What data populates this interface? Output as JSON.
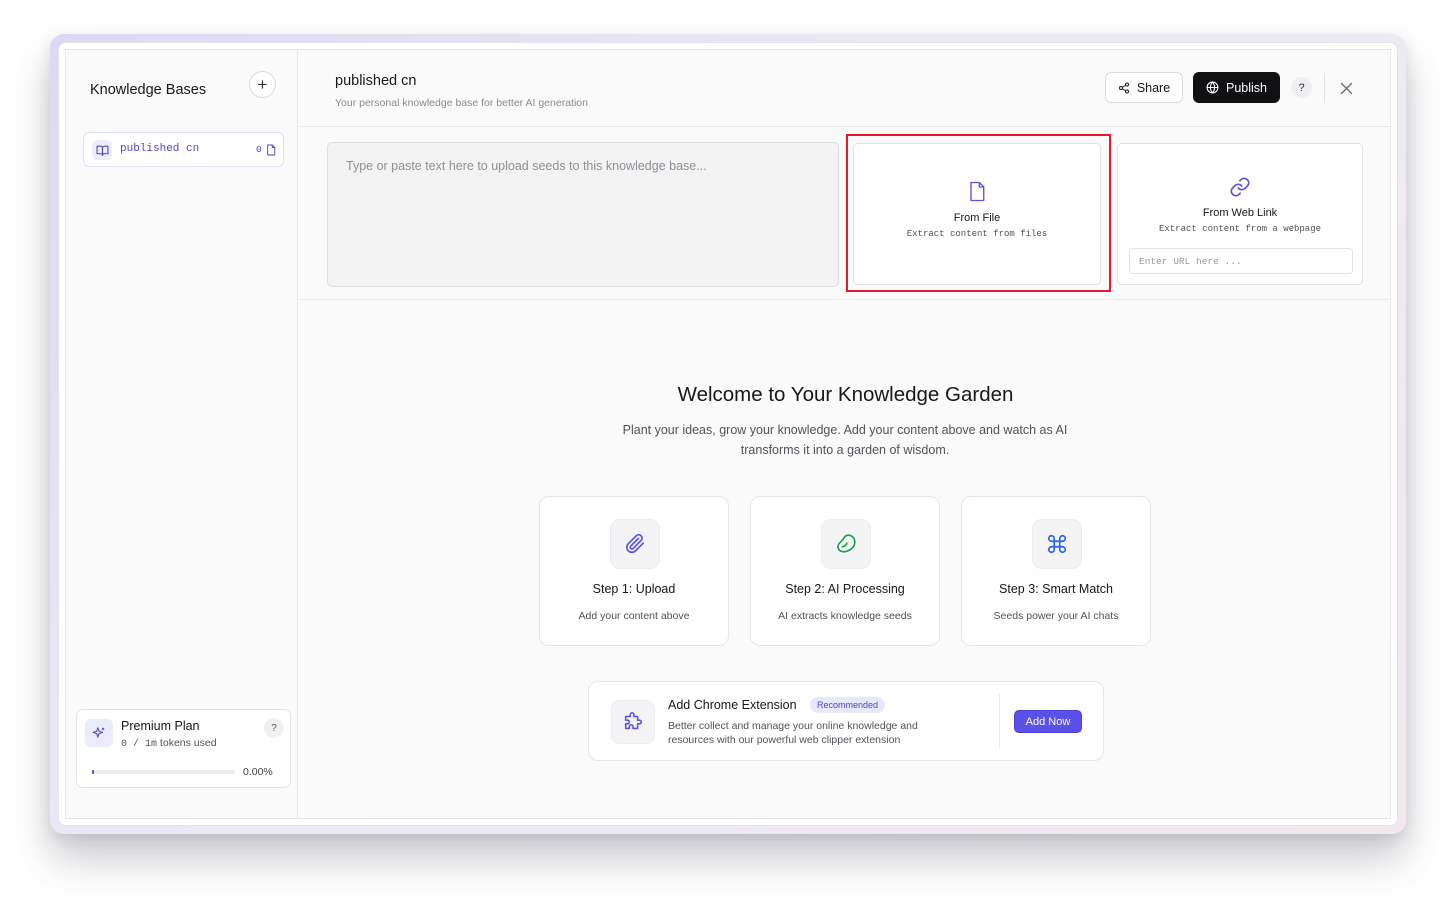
{
  "sidebar": {
    "title": "Knowledge Bases",
    "add_label": "+",
    "items": [
      {
        "name": "published cn",
        "count": "0"
      }
    ],
    "plan": {
      "name": "Premium Plan",
      "tokens_prefix": "0 / 1m",
      "tokens_suffix": " tokens used",
      "help_label": "?",
      "progress_percent": 0.0,
      "progress_label": "0.00%"
    }
  },
  "header": {
    "title": "published cn",
    "subtitle": "Your personal knowledge base for better AI generation",
    "share_label": "Share",
    "publish_label": "Publish",
    "help_label": "?"
  },
  "upload": {
    "text_placeholder": "Type or paste text here to upload seeds to this knowledge base...",
    "from_file": {
      "title": "From File",
      "subtitle": "Extract content from files"
    },
    "from_link": {
      "title": "From Web Link",
      "subtitle": "Extract content from a webpage",
      "url_placeholder": "Enter URL here ..."
    }
  },
  "welcome": {
    "title": "Welcome to Your Knowledge Garden",
    "description": "Plant your ideas, grow your knowledge. Add your content above and watch as AI transforms it into a garden of wisdom.",
    "steps": [
      {
        "title": "Step 1: Upload",
        "description": "Add your content above",
        "icon": "paperclip-icon",
        "color": "#5b50e8"
      },
      {
        "title": "Step 2: AI Processing",
        "description": "AI extracts knowledge seeds",
        "icon": "bean-icon",
        "color": "#16a34a"
      },
      {
        "title": "Step 3: Smart Match",
        "description": "Seeds power your AI chats",
        "icon": "command-icon",
        "color": "#2563eb"
      }
    ]
  },
  "extension": {
    "title": "Add Chrome Extension",
    "badge": "Recommended",
    "description": "Better collect and manage your online knowledge and resources with our powerful web clipper extension",
    "button_label": "Add Now"
  },
  "colors": {
    "accent": "#5b50e8",
    "highlight": "#e31b2e"
  }
}
